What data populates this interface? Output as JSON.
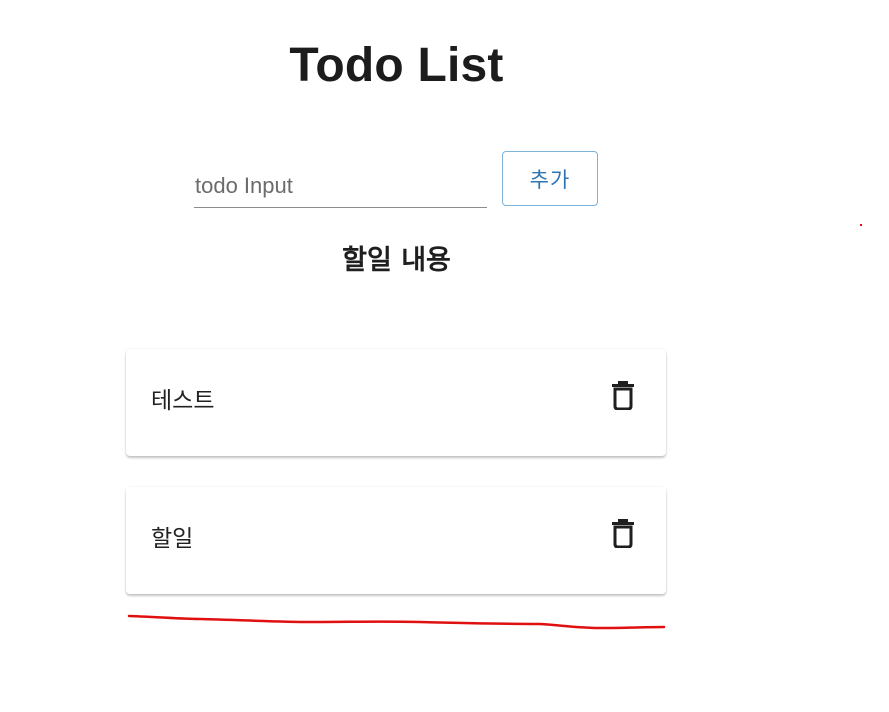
{
  "title": "Todo List",
  "input": {
    "placeholder": "todo Input",
    "value": ""
  },
  "add_button_label": "추가",
  "list_heading": "할일 내용",
  "todos": [
    {
      "text": "테스트",
      "delete_icon": "trash-icon"
    },
    {
      "text": "할일",
      "delete_icon": "trash-icon"
    }
  ],
  "colors": {
    "accent": "#2f75b5",
    "button_border": "#7fb2d9",
    "annotation": "#e01010"
  }
}
